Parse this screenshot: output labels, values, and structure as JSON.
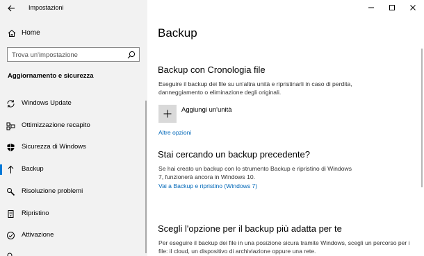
{
  "app": {
    "title": "Impostazioni"
  },
  "sidebar": {
    "home_label": "Home",
    "search_placeholder": "Trova un'impostazione",
    "section_heading": "Aggiornamento e sicurezza",
    "items": [
      {
        "label": "Windows Update",
        "icon": "sync-icon"
      },
      {
        "label": "Ottimizzazione recapito",
        "icon": "delivery-optimization-icon"
      },
      {
        "label": "Sicurezza di Windows",
        "icon": "shield-icon"
      },
      {
        "label": "Backup",
        "icon": "backup-arrow-icon",
        "selected": true
      },
      {
        "label": "Risoluzione problemi",
        "icon": "wrench-icon"
      },
      {
        "label": "Ripristino",
        "icon": "recovery-icon"
      },
      {
        "label": "Attivazione",
        "icon": "activation-check-icon"
      }
    ]
  },
  "main": {
    "title": "Backup",
    "file_history": {
      "heading": "Backup con Cronologia file",
      "description": "Eseguire il backup dei file su un'altra unità e ripristinarli in caso di perdita, danneggiamento o eliminazione degli originali.",
      "add_drive_label": "Aggiungi un'unità",
      "more_options_link": "Altre opzioni"
    },
    "older_backup": {
      "heading": "Stai cercando un backup precedente?",
      "description": "Se hai creato un backup con lo strumento Backup e ripristino di Windows 7, funzionerà ancora in Windows 10.",
      "link": "Vai a Backup e ripristino (Windows 7)"
    },
    "choose_option": {
      "heading": "Scegli l'opzione per il backup più adatta per te",
      "description": "Per eseguire il backup dei file in una posizione sicura tramite Windows, scegli un percorso per i file: il cloud, un dispositivo di archiviazione oppure una rete."
    }
  },
  "colors": {
    "accent": "#0078d7",
    "link": "#0067b8",
    "sidebar_bg": "#f2f2f2"
  }
}
